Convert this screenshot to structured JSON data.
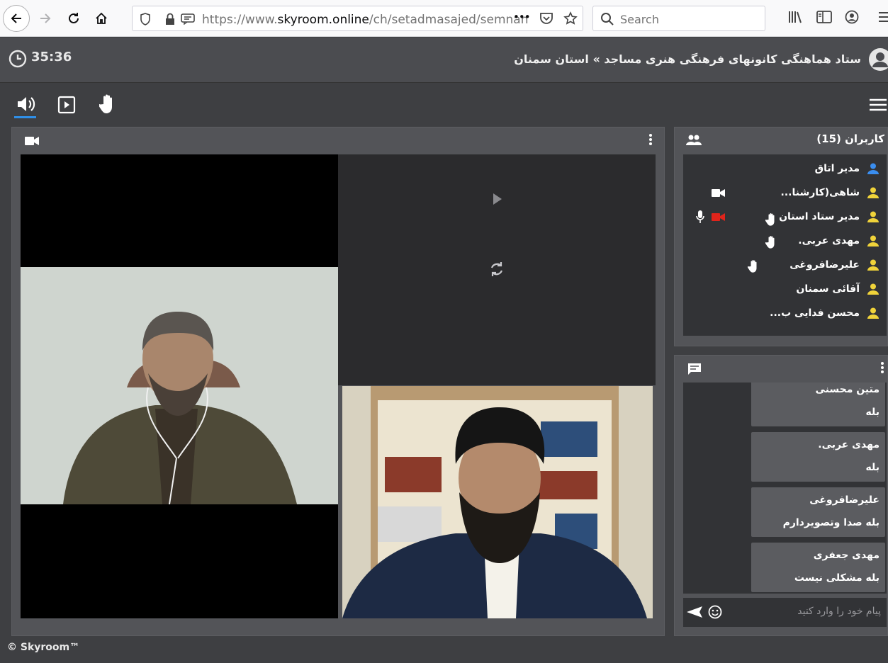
{
  "browser": {
    "url_prefix": "https://www.",
    "url_domain": "skyroom.online",
    "url_path": "/ch/setadmasajed/semnan",
    "search_placeholder": "Search",
    "more_label": "•••"
  },
  "header": {
    "timer": "35:36",
    "room_title": "ستاد هماهنگی کانونهای فرهنگی هنری مساجد » استان سمنان"
  },
  "users": {
    "title": "کاربران (15)",
    "items": [
      {
        "name": "مدیر اتاق",
        "role": "admin"
      },
      {
        "name": "شاهی(کارشنا...",
        "role": "user"
      },
      {
        "name": "مدیر ستاد استان",
        "role": "user"
      },
      {
        "name": "مهدی عربی.",
        "role": "user"
      },
      {
        "name": "علیرضافروغی",
        "role": "user"
      },
      {
        "name": "آقائی سمنان",
        "role": "user"
      },
      {
        "name": "محسن فدایی ب...",
        "role": "user"
      }
    ]
  },
  "chat": {
    "messages": [
      {
        "author": "متین محسنی",
        "text": "بله"
      },
      {
        "author": "مهدی عربی.",
        "text": "بله"
      },
      {
        "author": "علیرضافروغی",
        "text": "بله صدا وتصویردارم"
      },
      {
        "author": "مهدی جعفری",
        "text": "بله مشکلی نیست"
      }
    ],
    "input_placeholder": "پیام خود را وارد کنید"
  },
  "footer": {
    "text": "© Skyroom™"
  },
  "colors": {
    "accent": "#2f8fe8",
    "user_icon": "#f0d33a",
    "admin_icon": "#3a8ef0",
    "cam_off": "#e0241b"
  }
}
